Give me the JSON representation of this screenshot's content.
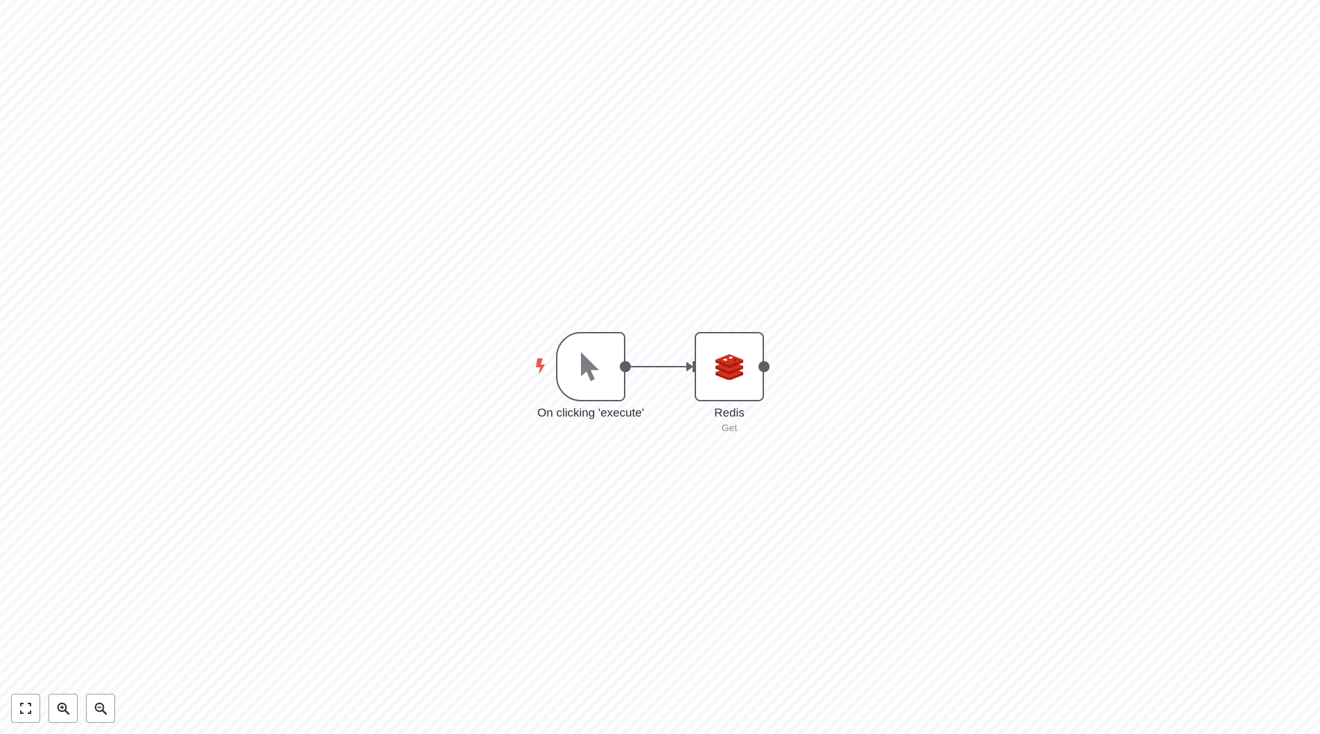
{
  "workflow": {
    "nodes": [
      {
        "id": "manual-trigger",
        "label": "On clicking 'execute'",
        "icon": "cursor-icon",
        "badge_icon": "lightning-bolt-icon"
      },
      {
        "id": "redis",
        "label": "Redis",
        "sublabel": "Get",
        "icon": "redis-logo-icon"
      }
    ],
    "connections": [
      {
        "from": "On clicking 'execute'",
        "to": "Redis"
      }
    ]
  },
  "controls": {
    "fit_view_icon": "fit-view-icon",
    "zoom_in_icon": "zoom-in-icon",
    "zoom_out_icon": "zoom-out-icon"
  },
  "colors": {
    "node_border": "#5b5f66",
    "trigger_bolt": "#ea5a4e",
    "redis_red": "#d82c20",
    "cursor_gray": "#7c7f85"
  }
}
